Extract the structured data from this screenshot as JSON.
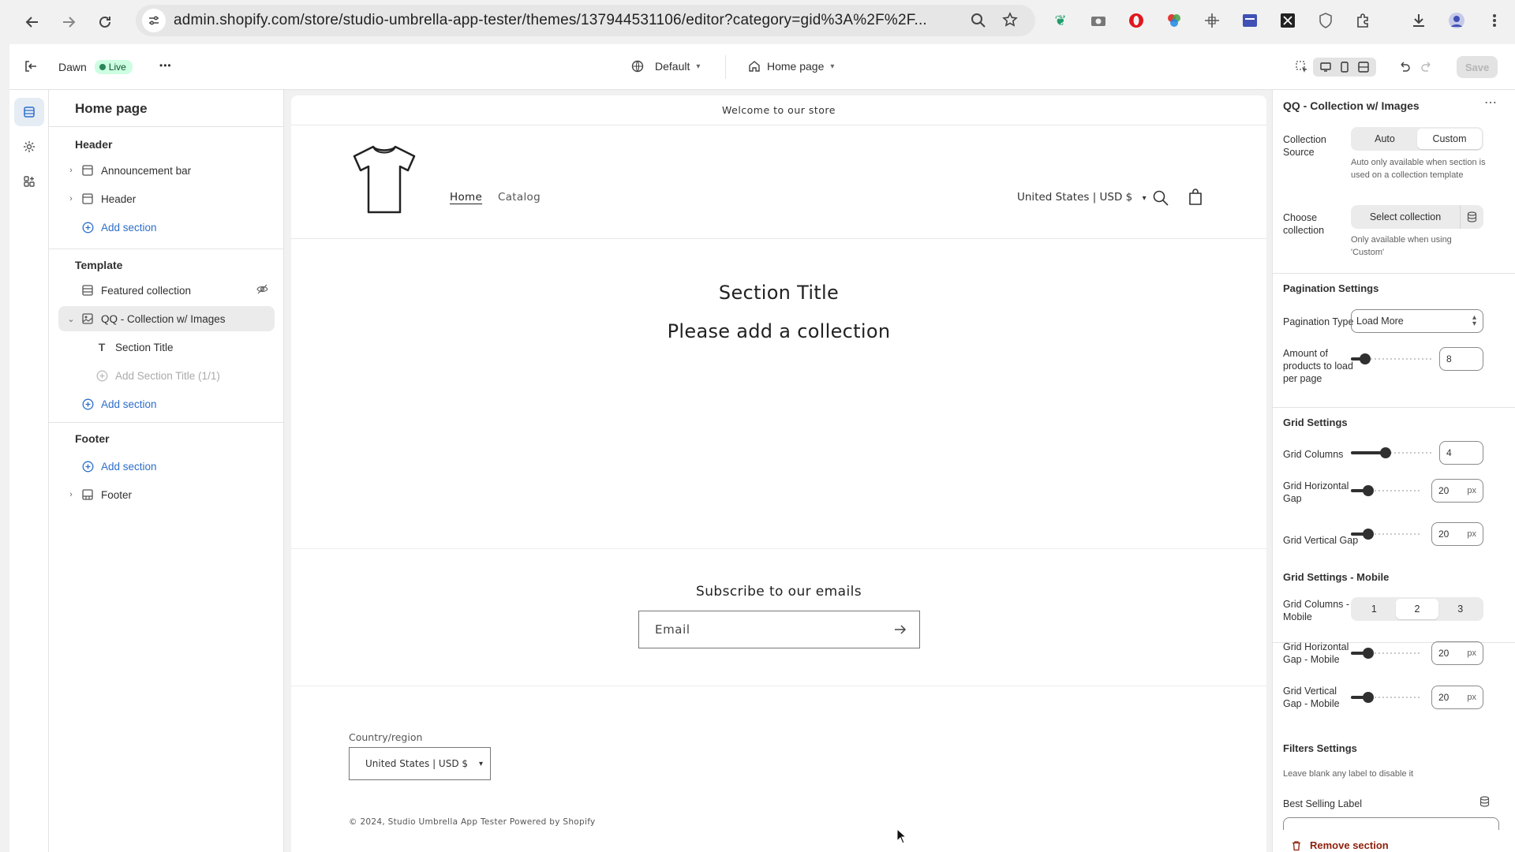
{
  "browser": {
    "url": "admin.shopify.com/store/studio-umbrella-app-tester/themes/137944531106/editor?category=gid%3A%2F%2F..."
  },
  "topbar": {
    "theme_name": "Dawn",
    "live_label": "Live",
    "more_label": "•••",
    "view_label": "Default",
    "page_label": "Home page",
    "save_label": "Save"
  },
  "sidebar": {
    "title": "Home page",
    "header_group": "Header",
    "header_items": [
      {
        "label": "Announcement bar"
      },
      {
        "label": "Header"
      }
    ],
    "add_section_label": "Add section",
    "template_group": "Template",
    "template_items": [
      {
        "label": "Featured collection"
      },
      {
        "label": "QQ - Collection w/ Images"
      }
    ],
    "block_items": [
      {
        "label": "Section Title"
      },
      {
        "label": "Add Section Title (1/1)"
      }
    ],
    "footer_group": "Footer",
    "footer_items": [
      {
        "label": "Footer"
      }
    ]
  },
  "preview": {
    "announcement": "Welcome to our store",
    "nav": [
      "Home",
      "Catalog"
    ],
    "locale": "United States | USD $",
    "section_title": "Section Title",
    "section_subtitle": "Please add a collection",
    "subscribe_title": "Subscribe to our emails",
    "email_label": "Email",
    "country_label": "Country/region",
    "country_value": "United States | USD $",
    "copyright": "© 2024, Studio Umbrella App Tester Powered by Shopify"
  },
  "settings": {
    "title": "QQ - Collection w/ Images",
    "collection_source_label": "Collection Source",
    "collection_source_options": [
      "Auto",
      "Custom"
    ],
    "collection_source_selected": "Custom",
    "collection_source_help": "Auto only available when section is used on a collection template",
    "choose_collection_label": "Choose collection",
    "select_collection_btn": "Select collection",
    "choose_collection_help": "Only available when using 'Custom'",
    "pagination_heading": "Pagination Settings",
    "pagination_type_label": "Pagination Type",
    "pagination_type_value": "Load More",
    "products_per_page_label": "Amount of products to load per page",
    "products_per_page_value": "8",
    "products_per_page_fraction": 0.12,
    "grid_heading": "Grid Settings",
    "grid_columns_label": "Grid Columns",
    "grid_columns_value": "4",
    "grid_columns_fraction": 0.42,
    "grid_hgap_label": "Grid Horizontal Gap",
    "grid_hgap_value": "20",
    "grid_hgap_fraction": 0.2,
    "grid_vgap_label": "Grid Vertical Gap",
    "grid_vgap_value": "20",
    "grid_vgap_fraction": 0.2,
    "unit_px": "px",
    "grid_mobile_heading": "Grid Settings - Mobile",
    "grid_columns_mobile_label": "Grid Columns - Mobile",
    "grid_columns_mobile_options": [
      "1",
      "2",
      "3"
    ],
    "grid_columns_mobile_selected": "2",
    "grid_hgap_mobile_label": "Grid Horizontal Gap - Mobile",
    "grid_hgap_mobile_value": "20",
    "grid_hgap_mobile_fraction": 0.2,
    "grid_vgap_mobile_label": "Grid Vertical Gap - Mobile",
    "grid_vgap_mobile_value": "20",
    "grid_vgap_mobile_fraction": 0.2,
    "filters_heading": "Filters Settings",
    "filters_help": "Leave blank any label to disable it",
    "best_selling_label": "Best Selling Label",
    "remove_section": "Remove section"
  },
  "colors": {
    "accent_blue": "#2c6ecb",
    "live_green": "#29845a",
    "danger": "#8e1f0b"
  }
}
